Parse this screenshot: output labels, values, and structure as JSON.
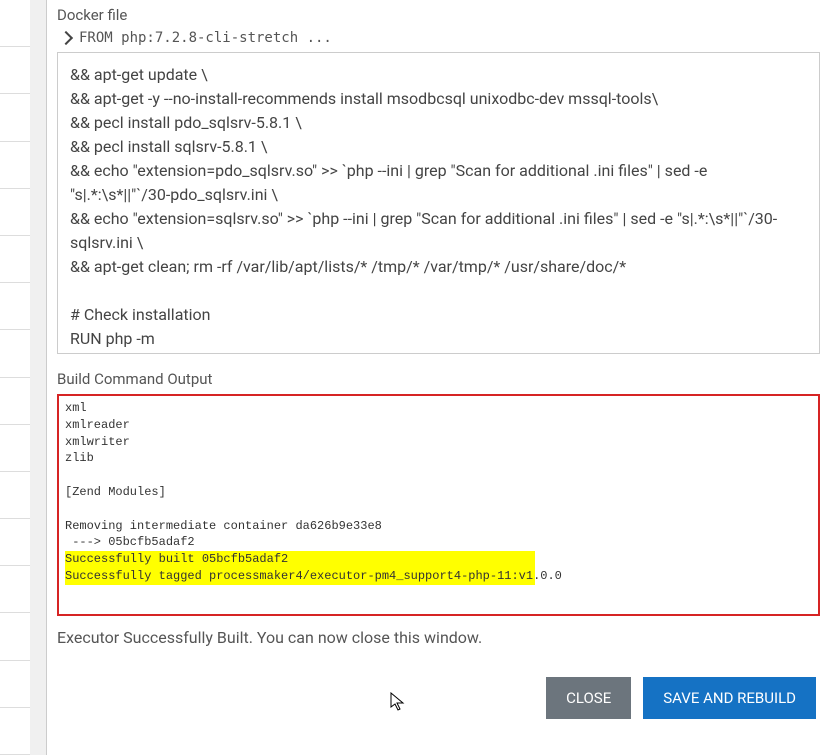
{
  "labels": {
    "docker_file": "Docker file",
    "from_line": "FROM php:7.2.8-cli-stretch ...",
    "build_output": "Build Command Output",
    "status": "Executor Successfully Built. You can now close this window.",
    "close": "CLOSE",
    "save_rebuild": "SAVE AND REBUILD"
  },
  "dockerfile_text": "&& apt-get update \\\n&& apt-get -y --no-install-recommends install msodbcsql unixodbc-dev mssql-tools\\\n&& pecl install pdo_sqlsrv-5.8.1 \\\n&& pecl install sqlsrv-5.8.1 \\\n&& echo \"extension=pdo_sqlsrv.so\" >> `php --ini | grep \"Scan for additional .ini files\" | sed -e \"s|.*:\\s*||\"`/30-pdo_sqlsrv.ini \\\n&& echo \"extension=sqlsrv.so\" >> `php --ini | grep \"Scan for additional .ini files\" | sed -e \"s|.*:\\s*||\"`/30-sqlsrv.ini \\\n&& apt-get clean; rm -rf /var/lib/apt/lists/* /tmp/* /var/tmp/* /usr/share/doc/*\n\n# Check installation\nRUN php -m",
  "output": {
    "pre_lines": "xml\nxmlreader\nxmlwriter\nzlib\n\n[Zend Modules]\n\nRemoving intermediate container da626b9e33e8\n ---> 05bcfb5adaf2",
    "hl_line1": "Successfully built 05bcfb5adaf2",
    "hl_line2": "Successfully tagged processmaker4/executor-pm4_support4-php-11:v1.0.0"
  }
}
